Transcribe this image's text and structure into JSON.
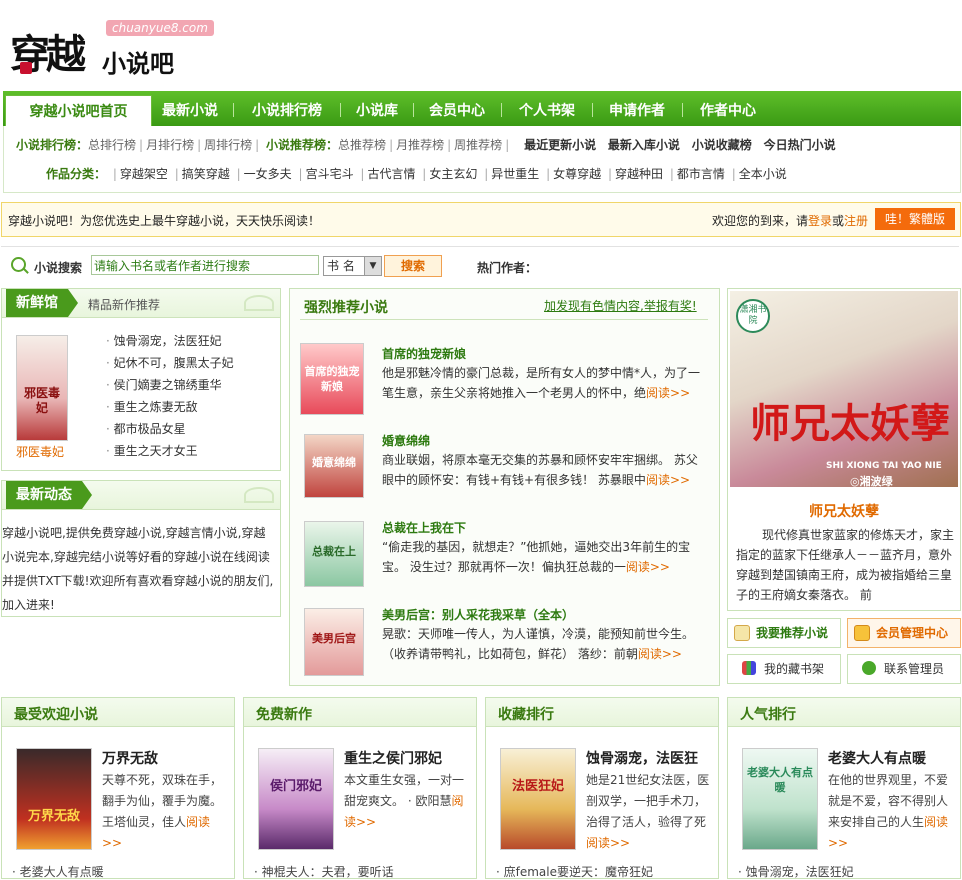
{
  "logo": {
    "main": "穿越",
    "sub": "小说吧",
    "domain": "chuanyue8.com"
  },
  "nav": {
    "tabs": [
      "穿越小说吧首页",
      "最新小说",
      "小说排行榜",
      "小说库",
      "会员中心",
      "个人书架",
      "申请作者",
      "作者中心"
    ]
  },
  "subnav": {
    "rank_label": "小说排行榜：",
    "rank_items": [
      "总排行榜",
      "月排行榜",
      "周排行榜"
    ],
    "recommend_label": "小说推荐榜：",
    "recommend_items": [
      "总推荐榜",
      "月推荐榜",
      "周推荐榜"
    ],
    "bold_links": [
      "最近更新小说",
      "最新入库小说",
      "小说收藏榜",
      "今日热门小说"
    ],
    "category_label": "作品分类：",
    "categories": [
      "穿越架空",
      "搞笑穿越",
      "一女多夫",
      "宫斗宅斗",
      "古代言情",
      "女主玄幻",
      "异世重生",
      "女尊穿越",
      "穿越种田",
      "都市言情",
      "全本小说"
    ]
  },
  "notice": {
    "left": "穿越小说吧！为您优选史上最牛穿越小说，天天快乐阅读！",
    "welcome": "欢迎您的到来，请",
    "login": "登录",
    "or": "或",
    "register": "注册",
    "trad_button": "哇！繁體版"
  },
  "search": {
    "label": "小说搜索",
    "placeholder": "请输入书名或者作者进行搜索",
    "type": "书 名",
    "button": "搜索",
    "hot_authors": "热门作者："
  },
  "fresh": {
    "tab": "新鲜馆",
    "subtitle": "精品新作推荐",
    "cover_caption": "邪医毒妃",
    "items": [
      "蚀骨溺宠，法医狂妃",
      "妃休不可，腹黑太子妃",
      "侯门嫡妻之锦绣重华",
      "重生之炼妻无敌",
      "都市极品女星",
      "重生之天才女王"
    ]
  },
  "news": {
    "tab": "最新动态",
    "text": "穿越小说吧,提供免费穿越小说,穿越言情小说,穿越小说完本,穿越完结小说等好看的穿越小说在线阅读并提供TXT下载!欢迎所有喜欢看穿越小说的朋友们,加入进来!"
  },
  "recommend": {
    "title": "强烈推荐小说",
    "report": "加发现有色情内容,举报有奖!",
    "more": "阅读>>",
    "items": [
      {
        "title": "首席的独宠新娘",
        "desc": "他是邪魅冷情的豪门总裁，是所有女人的梦中情*人，为了一笔生意，亲生父亲将她推入一个老男人的怀中，绝",
        "cover": "首席的独宠新娘"
      },
      {
        "title": "婚意绵绵",
        "desc": "商业联姻，将原本毫无交集的苏暴和顾怀安牢牢捆绑。 苏父眼中的顾怀安：有钱+有钱+有很多钱！ 苏暴眼中",
        "cover": "婚意绵绵"
      },
      {
        "title": "总裁在上我在下",
        "desc": "“偷走我的基因，就想走？”他抓她，逼她交出3年前生的宝宝。 没生过？那就再怀一次！偏执狂总裁的一",
        "cover": "总裁在上"
      },
      {
        "title": "美男后宫：别人采花我采草（全本）",
        "desc": "晃歌：天师唯一传人，为人谨慎，冷漠，能预知前世今生。（收养请带鸭礼，比如荷包，鲜花） 落纱：前朝",
        "cover": "美男后宫"
      }
    ]
  },
  "featured": {
    "publisher": "潇湘书院",
    "cover_big": "师兄太妖孽",
    "cover_pinyin": "SHI XIONG TAI YAO NIE",
    "cover_author": "◎湘波绿",
    "title": "师兄太妖孽",
    "desc": "现代修真世家蓝家的修炼天才，家主指定的蓝家下任继承人－－蓝齐月，意外穿越到楚国镇南王府，成为被指婚给三皇子的王府嫡女秦落衣。 前"
  },
  "side_buttons": [
    "我要推荐小说",
    "会员管理中心",
    "我的藏书架",
    "联系管理员"
  ],
  "columns": [
    {
      "head": "最受欢迎小说",
      "title": "万界无敌",
      "desc": "天尊不死，双珠在手，翻手为仙，覆手为魔。王塔仙灵，佳人",
      "more": "阅读>>",
      "cover": "万界无敌",
      "foot": "· 老婆大人有点暖"
    },
    {
      "head": "免费新作",
      "title": "重生之侯门邪妃",
      "desc": "本文重生女强，一对一甜宠爽文。 · 欧阳慧",
      "more": "阅读>>",
      "cover": "侯门邪妃",
      "foot": "· 神棍夫人：夫君，要听话"
    },
    {
      "head": "收藏排行",
      "title": "蚀骨溺宠，法医狂",
      "desc": "她是21世纪女法医，医剖双学，一把手术刀，治得了活人，验得了死",
      "more": "阅读>>",
      "cover": "法医狂妃",
      "foot": "· 庶female要逆天：魔帝狂妃"
    },
    {
      "head": "人气排行",
      "title": "老婆大人有点暖",
      "desc": "在他的世界观里，不爱就是不爱，容不得别人来安排自己的人生",
      "more": "阅读>>",
      "cover": "老婆大人有点暖",
      "foot": "· 蚀骨溺宠，法医狂妃"
    }
  ]
}
